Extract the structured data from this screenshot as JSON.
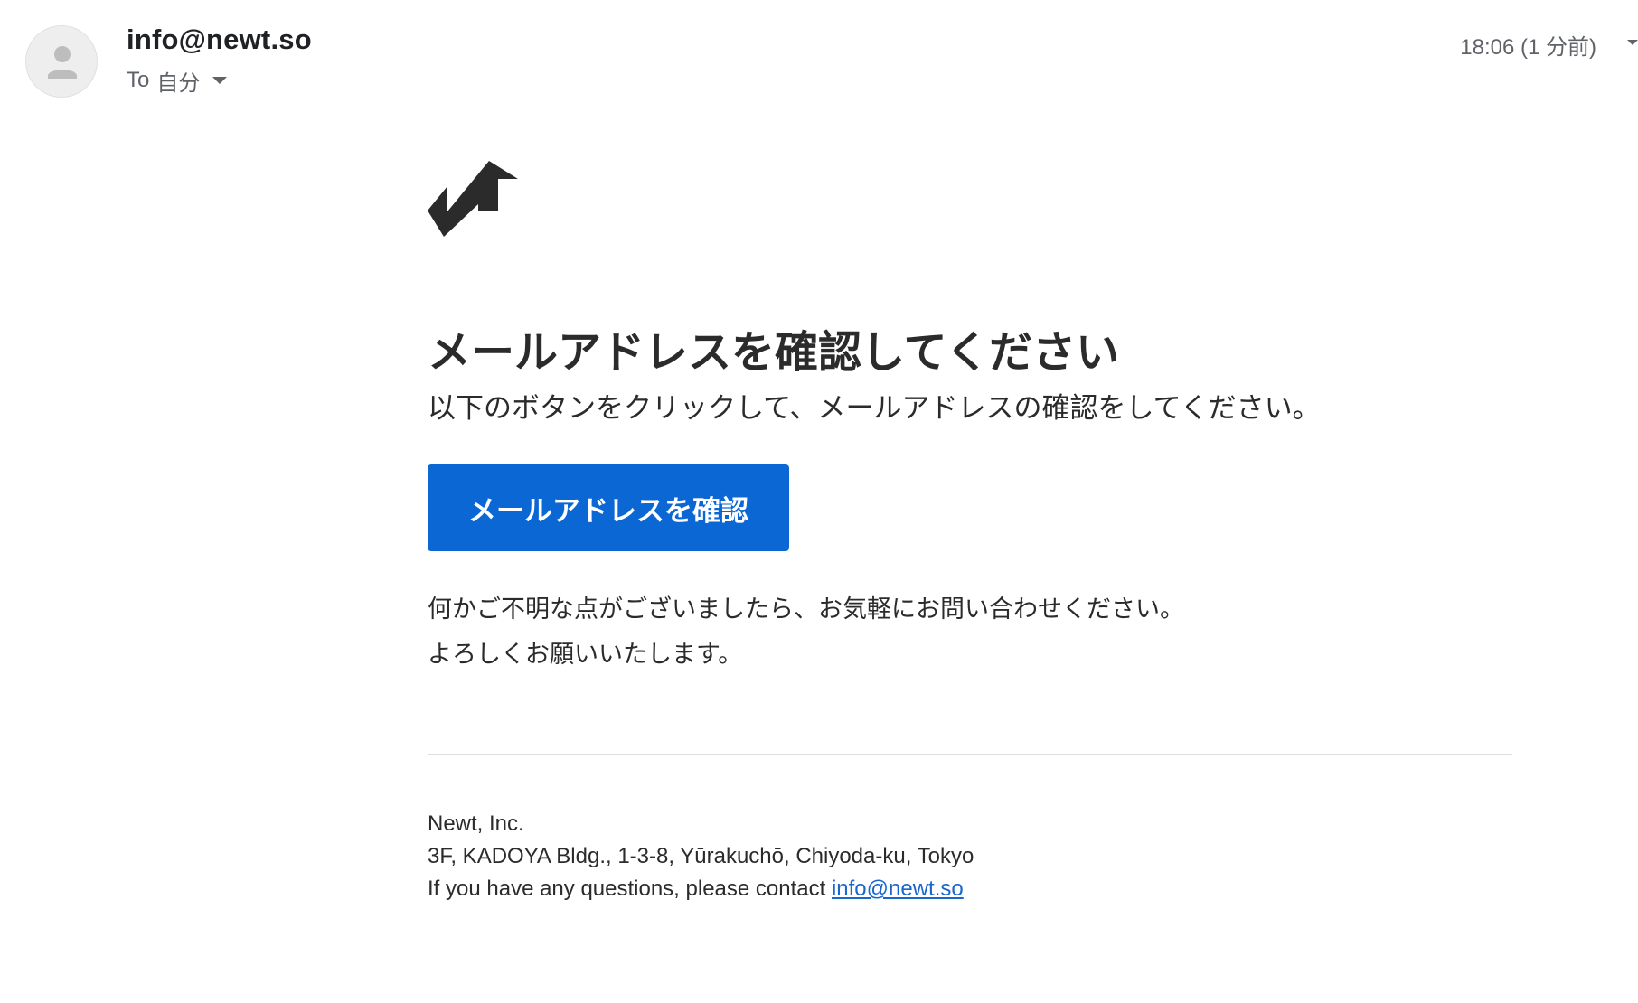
{
  "header": {
    "avatar_icon": "person-icon",
    "sender": "info@newt.so",
    "to_label": "To",
    "recipient": "自分",
    "timestamp": "18:06 (1 分前)"
  },
  "email": {
    "logo_icon": "newt-logo",
    "headline": "メールアドレスを確認してください",
    "subhead": "以下のボタンをクリックして、メールアドレスの確認をしてください。",
    "button_label": "メールアドレスを確認",
    "body_line_1": "何かご不明な点がございましたら、お気軽にお問い合わせください。",
    "body_line_2": "よろしくお願いいたします。"
  },
  "footer": {
    "company": "Newt, Inc.",
    "address": "3F, KADOYA Bldg., 1-3-8, Yūrakuchō, Chiyoda-ku, Tokyo",
    "contact_prefix": "If you have any questions, please contact ",
    "contact_email": "info@newt.so"
  },
  "colors": {
    "accent": "#0a67d4",
    "link": "#1a66cc",
    "text": "#2b2b2b",
    "muted": "#5f6368"
  }
}
